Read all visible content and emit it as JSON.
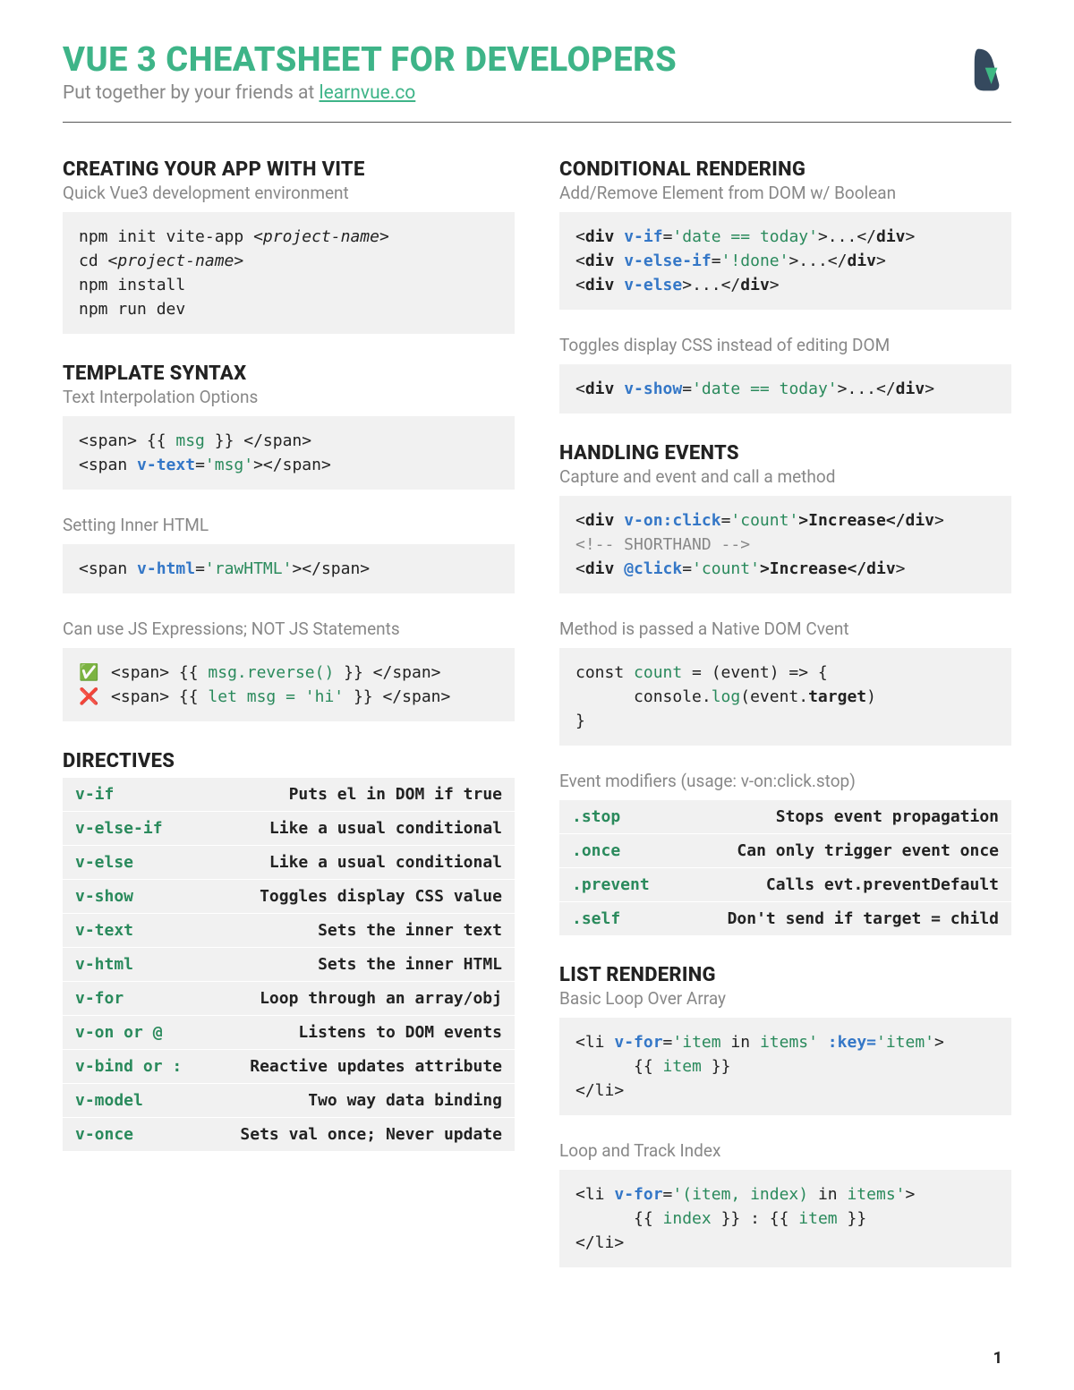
{
  "header": {
    "title": "VUE 3 CHEATSHEET FOR DEVELOPERS",
    "subtitle_prefix": "Put together by your friends at ",
    "subtitle_link": "learnvue.co"
  },
  "page_number": "1",
  "left": {
    "s1": {
      "title": "CREATING YOUR APP WITH VITE",
      "sub": "Quick Vue3 development environment",
      "code": {
        "l1": "npm init vite-app ",
        "l1i": "<project-name>",
        "l2": "cd ",
        "l2i": "<project-name>",
        "l3": "npm install",
        "l4": "npm run dev"
      }
    },
    "s2": {
      "title": "TEMPLATE SYNTAX",
      "sub1": "Text Interpolation Options",
      "code1": {
        "a": "<span> {{ ",
        "b": "msg",
        "c": " }} </span>",
        "d": "<span ",
        "e": "v-text",
        "f": "=",
        "g": "'msg'",
        "h": "></span>"
      },
      "sub2": "Setting Inner HTML",
      "code2": {
        "a": "<span ",
        "b": "v-html",
        "c": "=",
        "d": "'rawHTML'",
        "e": "></span>"
      },
      "sub3": "Can use JS Expressions; NOT JS Statements",
      "code3": {
        "ok": "✅",
        "a": " <span> {{ ",
        "b": "msg.reverse()",
        "c": " }} </span>",
        "bad": "❌",
        "d": " <span> {{ ",
        "e": "let msg = 'hi'",
        "f": " }} </span>"
      }
    },
    "s3": {
      "title": "DIRECTIVES",
      "rows": [
        {
          "name": "v-if",
          "desc": "Puts el in DOM if true"
        },
        {
          "name": "v-else-if",
          "desc": "Like a usual conditional"
        },
        {
          "name": "v-else",
          "desc": "Like a usual conditional"
        },
        {
          "name": "v-show",
          "desc": "Toggles display CSS value"
        },
        {
          "name": "v-text",
          "desc": "Sets the inner text"
        },
        {
          "name": "v-html",
          "desc": "Sets the inner HTML"
        },
        {
          "name": "v-for",
          "desc": "Loop through an array/obj"
        },
        {
          "name": "v-on or @",
          "desc": "Listens to DOM events"
        },
        {
          "name": "v-bind or :",
          "desc": "Reactive updates attribute"
        },
        {
          "name": "v-model",
          "desc": "Two way data binding"
        },
        {
          "name": "v-once",
          "desc": "Sets val once; Never update"
        }
      ]
    }
  },
  "right": {
    "s1": {
      "title": "CONDITIONAL RENDERING",
      "sub1": "Add/Remove Element from DOM w/ Boolean",
      "code1": {
        "a": "<",
        "b": "div ",
        "c": "v-if",
        "d": "=",
        "e": "'date == today'",
        "f": ">...</",
        "g": "div",
        "h": ">",
        "i": "<",
        "j": "div ",
        "k": "v-else-if",
        "l": "=",
        "m": "'!done'",
        "n": ">...</",
        "o": "div",
        "p": ">",
        "q": "<",
        "r": "div ",
        "s": "v-else",
        "t": ">...</",
        "u": "div",
        "v": ">"
      },
      "sub2": "Toggles display CSS instead of editing DOM",
      "code2": {
        "a": "<",
        "b": "div ",
        "c": "v-show",
        "d": "=",
        "e": "'date == today'",
        "f": ">...</",
        "g": "div",
        "h": ">"
      }
    },
    "s2": {
      "title": "HANDLING EVENTS",
      "sub1": "Capture and event and call a method",
      "code1": {
        "a": "<",
        "b": "div ",
        "c": "v-on:click",
        "d": "=",
        "e": "'count'",
        "f": ">Increase</",
        "g": "div",
        "h": ">",
        "cmt": "<!-- SHORTHAND -->",
        "i": "<",
        "j": "div ",
        "k": "@click",
        "l": "=",
        "m": "'count'",
        "n": ">Increase</",
        "o": "div",
        "p": ">"
      },
      "sub2": "Method is passed a Native DOM Cvent",
      "code2": {
        "a": "const",
        "b": " count ",
        "c": "= (event) => {",
        "d": "      console.",
        "e": "log",
        "f": "(event.",
        "g": "target",
        "h": ")",
        "i": "}"
      },
      "sub3": "Event modifiers (usage: v-on:click.stop)",
      "rows": [
        {
          "name": ".stop",
          "desc": "Stops event propagation"
        },
        {
          "name": ".once",
          "desc": "Can only trigger event once"
        },
        {
          "name": ".prevent",
          "desc": "Calls evt.preventDefault"
        },
        {
          "name": ".self",
          "desc": "Don't send if target = child"
        }
      ]
    },
    "s3": {
      "title": "LIST RENDERING",
      "sub1": "Basic Loop Over Array",
      "code1": {
        "a": "<li ",
        "b": "v-for",
        "c": "=",
        "d": "'item",
        "e": " in ",
        "f": "items'",
        "g": " :key=",
        "h": "'item'",
        "i": ">",
        "j": "      {{ ",
        "k": "item",
        "l": " }}",
        "m": "</li>"
      },
      "sub2": "Loop and Track Index",
      "code2": {
        "a": "<li ",
        "b": "v-for",
        "c": "=",
        "d": "'(item, index) ",
        "e": "in ",
        "f": "items'",
        "g": ">",
        "h": "      {{ ",
        "i": "index",
        "j": " }} : {{ ",
        "k": "item",
        "l": " }}",
        "m": "</li>"
      }
    }
  }
}
